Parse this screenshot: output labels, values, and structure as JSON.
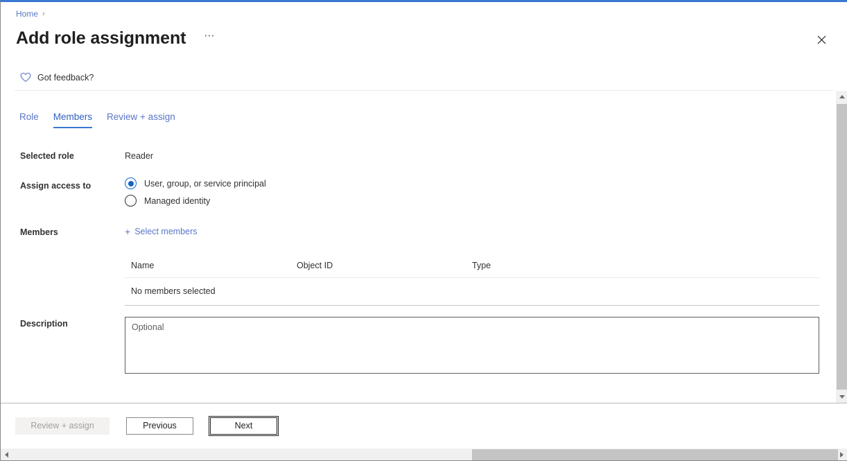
{
  "colors": {
    "accent_blue": "#3a78d1",
    "link_blue": "#5a77c7",
    "radio_blue": "#1665c0",
    "text_primary": "#323130",
    "text_disabled": "#a19f9d",
    "border_gray": "#8a8886"
  },
  "breadcrumb": {
    "home_label": "Home",
    "separator": "›"
  },
  "header": {
    "title": "Add role assignment",
    "more_label": "⋯",
    "close_label": "✕"
  },
  "feedback": {
    "icon": "heart-icon",
    "label": "Got feedback?"
  },
  "tabs": [
    {
      "id": "role",
      "label": "Role",
      "active": false
    },
    {
      "id": "members",
      "label": "Members",
      "active": true
    },
    {
      "id": "review-assign",
      "label": "Review + assign",
      "active": false
    }
  ],
  "form": {
    "selected_role": {
      "label": "Selected role",
      "value": "Reader"
    },
    "assign_access_to": {
      "label": "Assign access to",
      "options": [
        {
          "id": "user-group-sp",
          "label": "User, group, or service principal",
          "checked": true
        },
        {
          "id": "managed-identity",
          "label": "Managed identity",
          "checked": false
        }
      ]
    },
    "members": {
      "label": "Members",
      "select_link": "Select members",
      "plus_icon": "+",
      "table": {
        "columns": [
          "Name",
          "Object ID",
          "Type"
        ],
        "empty_message": "No members selected",
        "rows": []
      }
    },
    "description": {
      "label": "Description",
      "placeholder": "Optional",
      "value": ""
    }
  },
  "footer": {
    "review_assign": {
      "label": "Review + assign",
      "disabled": true
    },
    "previous": {
      "label": "Previous",
      "disabled": false
    },
    "next": {
      "label": "Next",
      "disabled": false,
      "focused": true
    }
  },
  "scrollbars": {
    "vertical": {
      "up": "▲",
      "down": "▼"
    },
    "horizontal": {
      "left": "◀",
      "right": "▶"
    }
  }
}
